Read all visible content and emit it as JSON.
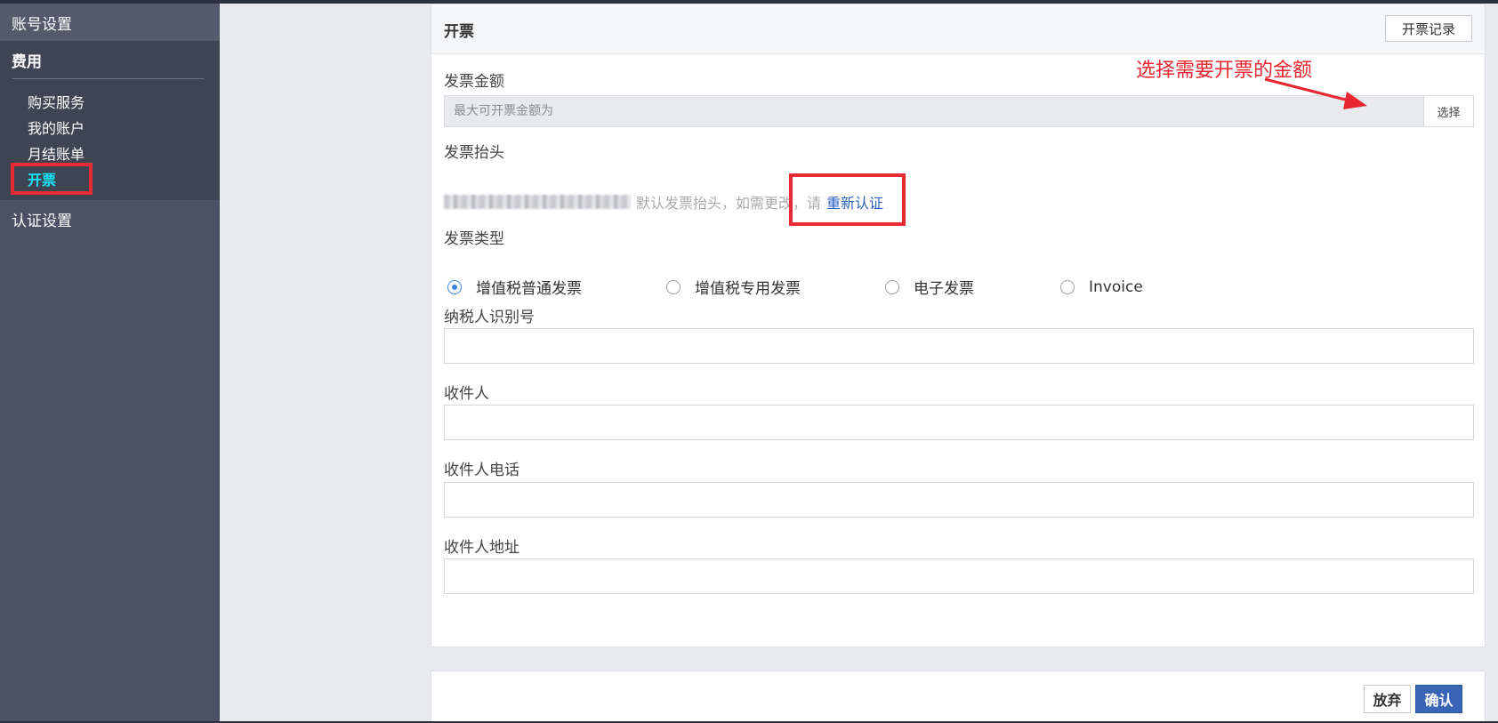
{
  "sidebar": {
    "account_settings": "账号设置",
    "fees_section": "费用",
    "items": [
      {
        "label": "购买服务"
      },
      {
        "label": "我的账户"
      },
      {
        "label": "月结账单"
      },
      {
        "label": "开票"
      }
    ],
    "auth_settings": "认证设置"
  },
  "card": {
    "title": "开票",
    "record_button": "开票记录",
    "amount_label": "发票金额",
    "amount_placeholder": "最大可开票金额为",
    "select_button": "选择",
    "title_label": "发票抬头",
    "title_hint": "默认发票抬头，如需更改，请",
    "recertify_link": "重新认证",
    "type_label": "发票类型",
    "types": [
      {
        "label": "增值税普通发票",
        "checked": true
      },
      {
        "label": "增值税专用发票",
        "checked": false
      },
      {
        "label": "电子发票",
        "checked": false
      },
      {
        "label": "Invoice",
        "checked": false
      }
    ],
    "taxpayer_label": "纳税人识别号",
    "recipient_label": "收件人",
    "phone_label": "收件人电话",
    "address_label": "收件人地址"
  },
  "footer": {
    "cancel_button": "放弃",
    "confirm_button": "确认"
  },
  "annotation": {
    "text": "选择需要开票的金额"
  },
  "colors": {
    "sidebar_bg": "#4a5263",
    "active_item": "#17e6ff",
    "highlight_red": "#e82c35",
    "link_blue": "#2b5fbd",
    "confirm_bg": "#3a64b5",
    "radio_checked": "#3a86e8"
  }
}
